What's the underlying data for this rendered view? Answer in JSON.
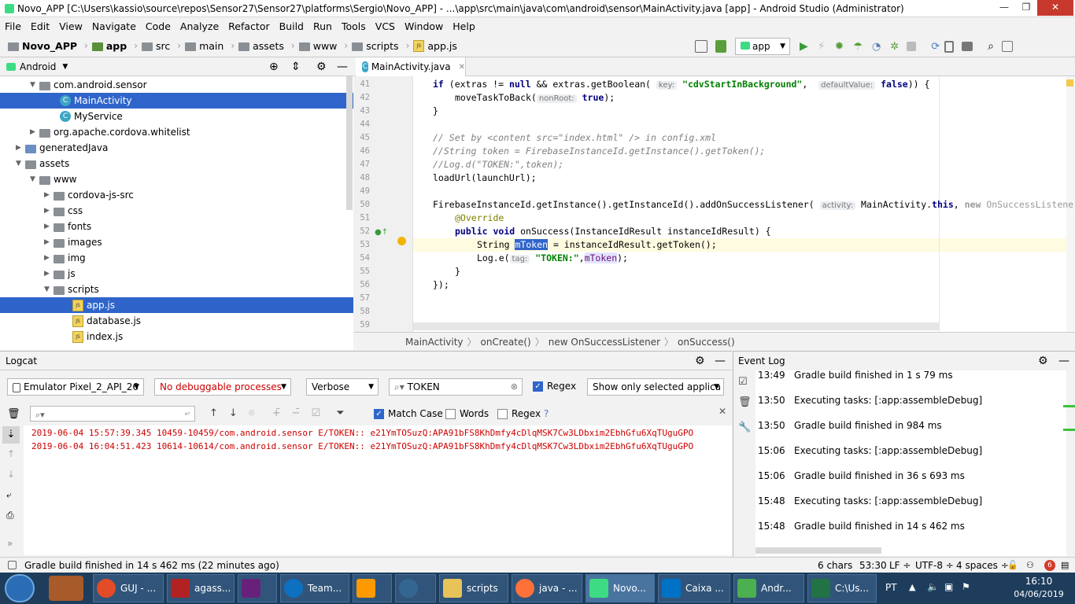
{
  "window": {
    "title": "Novo_APP [C:\\Users\\kassio\\source\\repos\\Sensor27\\Sensor27\\platforms\\Sergio\\Novo_APP] - ...\\app\\src\\main\\java\\com\\android\\sensor\\MainActivity.java [app] - Android Studio (Administrator)"
  },
  "menu": [
    "File",
    "Edit",
    "View",
    "Navigate",
    "Code",
    "Analyze",
    "Refactor",
    "Build",
    "Run",
    "Tools",
    "VCS",
    "Window",
    "Help"
  ],
  "breadcrumb": [
    "Novo_APP",
    "app",
    "src",
    "main",
    "assets",
    "www",
    "scripts",
    "app.js"
  ],
  "toolbar": {
    "run_config": "app"
  },
  "project": {
    "view": "Android",
    "tree": [
      {
        "label": "com.android.sensor",
        "kind": "package",
        "expanded": true
      },
      {
        "label": "MainActivity",
        "kind": "class",
        "selected": true
      },
      {
        "label": "MyService",
        "kind": "class"
      },
      {
        "label": "org.apache.cordova.whitelist",
        "kind": "package",
        "expanded": false
      },
      {
        "label": "generatedJava",
        "kind": "folder",
        "expanded": false
      },
      {
        "label": "assets",
        "kind": "folder",
        "expanded": true
      },
      {
        "label": "www",
        "kind": "folder",
        "expanded": true
      },
      {
        "label": "cordova-js-src",
        "kind": "folder",
        "expanded": false
      },
      {
        "label": "css",
        "kind": "folder",
        "expanded": false
      },
      {
        "label": "fonts",
        "kind": "folder",
        "expanded": false
      },
      {
        "label": "images",
        "kind": "folder",
        "expanded": false
      },
      {
        "label": "img",
        "kind": "folder",
        "expanded": false
      },
      {
        "label": "js",
        "kind": "folder",
        "expanded": false
      },
      {
        "label": "scripts",
        "kind": "folder",
        "expanded": true
      },
      {
        "label": "app.js",
        "kind": "js",
        "selected": true
      },
      {
        "label": "database.js",
        "kind": "js"
      },
      {
        "label": "index.js",
        "kind": "js"
      }
    ]
  },
  "editor": {
    "tab": "MainActivity.java",
    "line_numbers": [
      "41",
      "42",
      "43",
      "44",
      "45",
      "46",
      "47",
      "48",
      "49",
      "50",
      "51",
      "52",
      "53",
      "54",
      "55",
      "56",
      "57",
      "58",
      "59"
    ],
    "code": {
      "l41a": "if",
      "l41b": " (extras != ",
      "l41c": "null",
      "l41d": " && extras.getBoolean(",
      "l41hint1": "key:",
      "l41str": "\"cdvStartInBackground\"",
      "l41e": ", ",
      "l41hint2": "defaultValue:",
      "l41f": "false",
      "l41g": ")) {",
      "l42a": "moveTaskToBack(",
      "l42hint": "nonRoot:",
      "l42b": "true",
      "l42c": ");",
      "l43": "}",
      "l45": "// Set by <content src=\"index.html\" /> in config.xml",
      "l46": "//String token = FirebaseInstanceId.getInstance().getToken();",
      "l47": "//Log.d(\"TOKEN:\",token);",
      "l48": "loadUrl(launchUrl);",
      "l50a": "FirebaseInstanceId.getInstance().getInstanceId().addOnSuccessListener(",
      "l50hint": "activity:",
      "l50b": " MainActivity.",
      "l50c": "this",
      "l50d": ", ",
      "l50e": "new",
      "l50f": " OnSuccessListener",
      "l51": "@Override",
      "l52a": "public",
      "l52b": " ",
      "l52c": "void",
      "l52d": " onSuccess(InstanceIdResult instanceIdResult) {",
      "l53a": "String ",
      "l53b": "mToken",
      "l53c": " = instanceIdResult.getToken();",
      "l54a": "Log.e(",
      "l54hint": "tag:",
      "l54str": "\"TOKEN:\"",
      "l54b": ",",
      "l54c": "mToken",
      "l54d": ");",
      "l55": "}",
      "l56": "});"
    },
    "crumbs": [
      "MainActivity",
      "onCreate()",
      "new OnSuccessListener",
      "onSuccess()"
    ]
  },
  "logcat": {
    "title": "Logcat",
    "device": "Emulator Pixel_2_API_26",
    "process": "No debuggable processes",
    "level": "Verbose",
    "search": "TOKEN",
    "regex_label": "Regex",
    "filter": "Show only selected applica",
    "match_case": "Match Case",
    "words": "Words",
    "regex2": "Regex",
    "help": "?",
    "lines": [
      "2019-06-04 15:57:39.345 10459-10459/com.android.sensor E/TOKEN:: e21YmTOSuzQ:APA91bFS8KhDmfy4cDlqMSK7Cw3LDbxim2EbhGfu6XqTUguGPO",
      "2019-06-04 16:04:51.423 10614-10614/com.android.sensor E/TOKEN:: e21YmTOSuzQ:APA91bFS8KhDmfy4cDlqMSK7Cw3LDbxim2EbhGfu6XqTUguGPO"
    ]
  },
  "eventlog": {
    "title": "Event Log",
    "entries": [
      {
        "time": "13:49",
        "text": "Gradle build finished in 1 s 79 ms"
      },
      {
        "time": "13:50",
        "text": "Executing tasks: [:app:assembleDebug]"
      },
      {
        "time": "13:50",
        "text": "Gradle build finished in 984 ms"
      },
      {
        "time": "15:06",
        "text": "Executing tasks: [:app:assembleDebug]"
      },
      {
        "time": "15:06",
        "text": "Gradle build finished in 36 s 693 ms"
      },
      {
        "time": "15:48",
        "text": "Executing tasks: [:app:assembleDebug]"
      },
      {
        "time": "15:48",
        "text": "Gradle build finished in 14 s 462 ms"
      }
    ]
  },
  "statusbar": {
    "message": "Gradle build finished in 14 s 462 ms (22 minutes ago)",
    "chars": "6 chars",
    "position": "53:30",
    "line_sep": "LF ÷",
    "encoding": "UTF-8 ÷",
    "indent": "4 spaces ÷",
    "notifications": "6"
  },
  "taskbar": {
    "items": [
      {
        "label": "GUJ - ...",
        "color": "#e34c26"
      },
      {
        "label": "agass...",
        "color": "#b22222"
      },
      {
        "label": "",
        "color": "#68217a"
      },
      {
        "label": "Team...",
        "color": "#0e70c0"
      },
      {
        "label": "",
        "color": "#ff9900"
      },
      {
        "label": "",
        "color": "#336791"
      },
      {
        "label": "scripts",
        "color": "#e8c35a"
      },
      {
        "label": "java - ...",
        "color": "#ff7139"
      },
      {
        "label": "Novo...",
        "color": "#3ddc84"
      },
      {
        "label": "Caixa ...",
        "color": "#0072c6"
      },
      {
        "label": "Andr...",
        "color": "#4caf50"
      },
      {
        "label": "C:\\Us...",
        "color": "#217346"
      }
    ],
    "lang": "PT",
    "time": "16:10",
    "date": "04/06/2019"
  }
}
